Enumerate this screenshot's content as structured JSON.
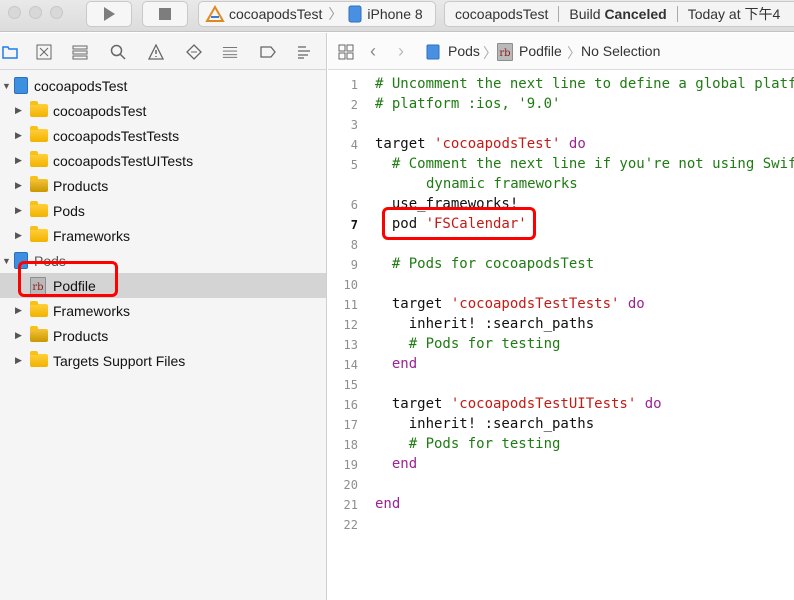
{
  "toolbar": {
    "scheme_target": "cocoapodsTest",
    "device": "iPhone 8",
    "activity_project": "cocoapodsTest",
    "build_prefix": "Build ",
    "build_status": "Canceled",
    "timestamp": "Today at 下午4"
  },
  "navigator": {
    "root": "cocoapodsTest",
    "items": [
      "cocoapodsTest",
      "cocoapodsTestTests",
      "cocoapodsTestUITests",
      "Products",
      "Pods",
      "Frameworks"
    ],
    "pods_project": "Pods",
    "pods_items": [
      "Podfile",
      "Frameworks",
      "Products",
      "Targets Support Files"
    ]
  },
  "jumpbar": {
    "project": "Pods",
    "file": "Podfile",
    "selection": "No Selection"
  },
  "editor": {
    "current_line": 7,
    "lines": [
      "# Uncomment the next line to define a global platf",
      "# platform :ios, '9.0'",
      "",
      "target 'cocoapodsTest' do",
      "  # Comment the next line if you're not using Swif",
      "  use_frameworks!",
      "  pod 'FSCalendar'",
      "",
      "  # Pods for cocoapodsTest",
      "",
      "  target 'cocoapodsTestTests' do",
      "    inherit! :search_paths",
      "    # Pods for testing",
      "  end",
      "",
      "  target 'cocoapodsTestUITests' do",
      "    inherit! :search_paths",
      "    # Pods for testing",
      "  end",
      "",
      "end",
      ""
    ],
    "wrap_line_5": "dynamic frameworks",
    "line_numbers": [
      "1",
      "2",
      "3",
      "4",
      "5",
      "6",
      "7",
      "8",
      "9",
      "10",
      "11",
      "12",
      "13",
      "14",
      "15",
      "16",
      "17",
      "18",
      "19",
      "20",
      "21",
      "22"
    ]
  }
}
